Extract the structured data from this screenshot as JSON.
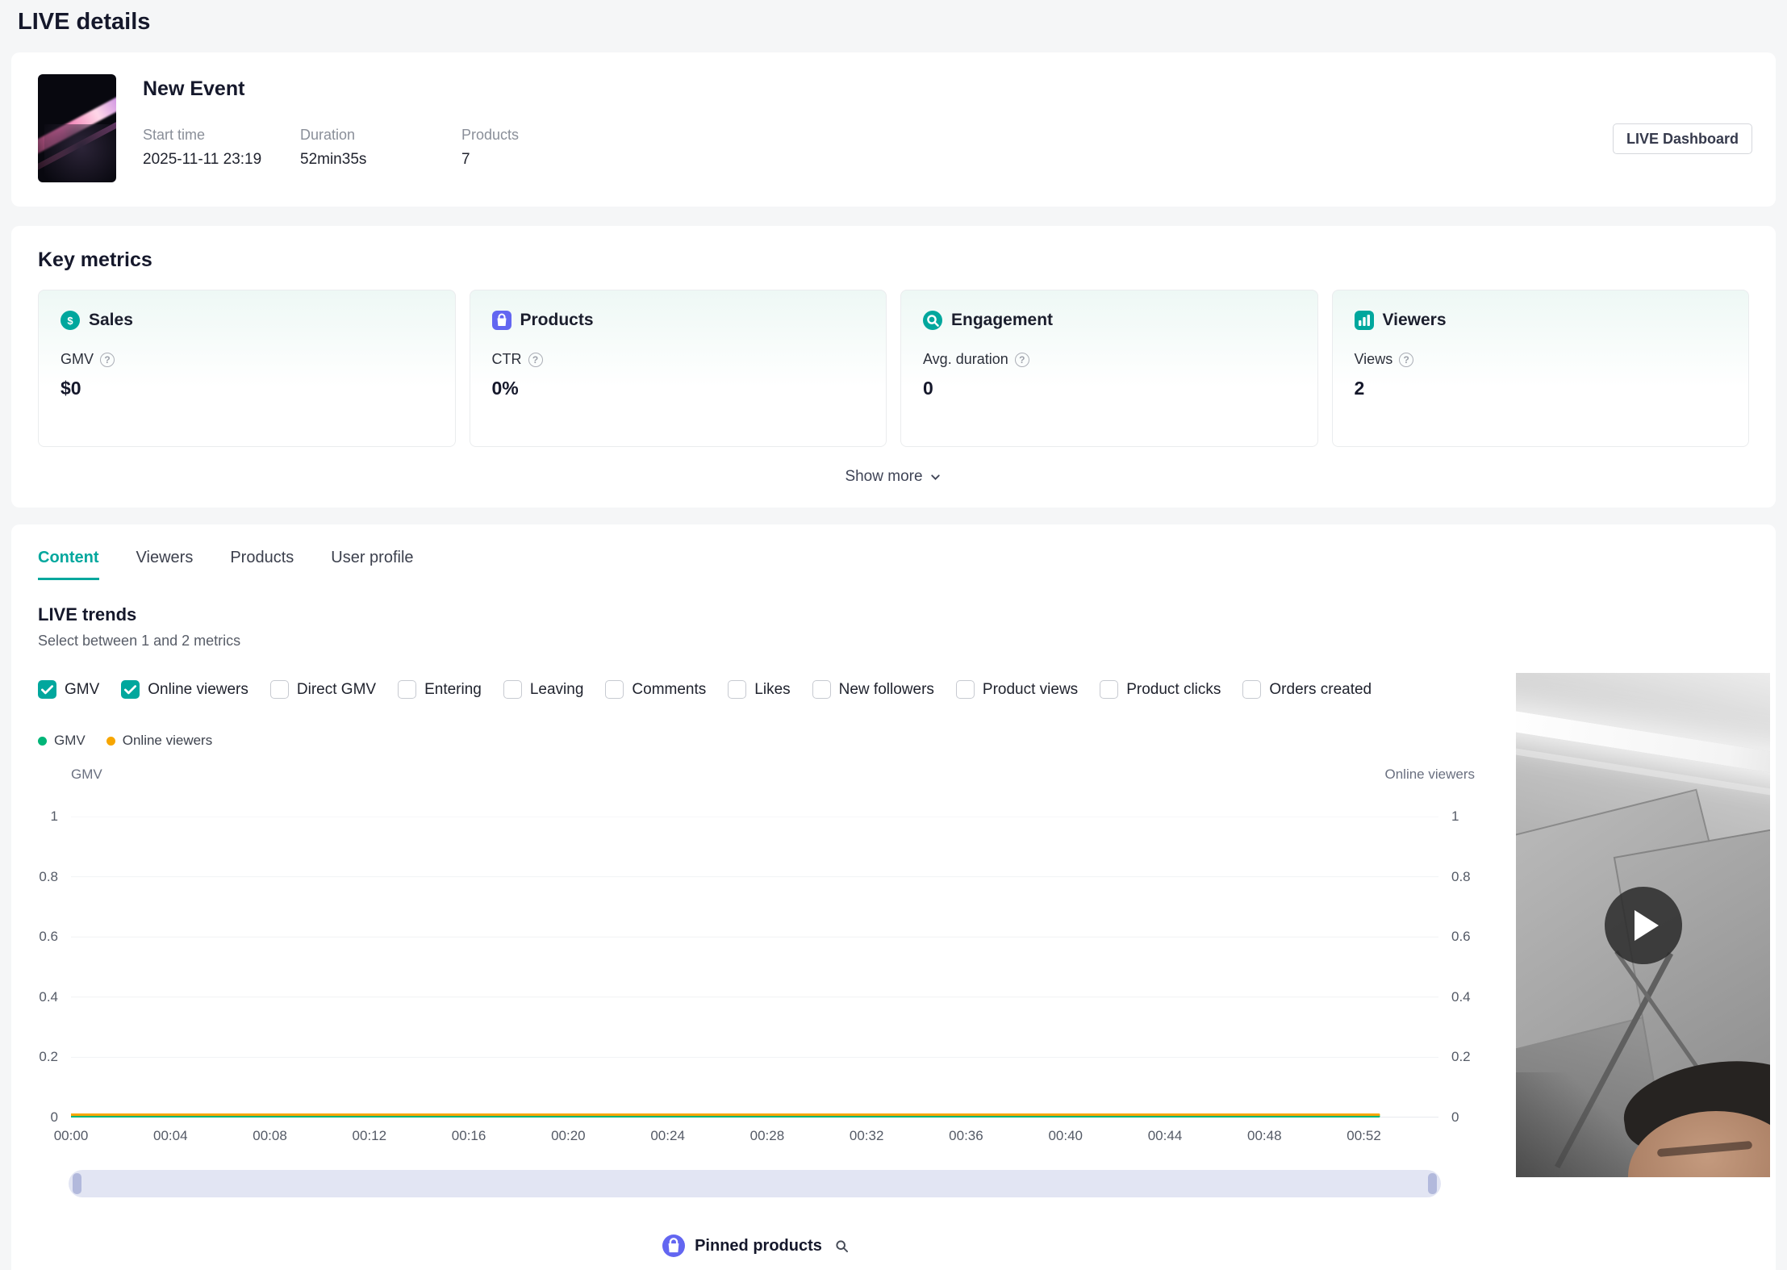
{
  "page": {
    "title": "LIVE details"
  },
  "accent_color": "#00a79d",
  "event": {
    "name": "New Event",
    "fields": [
      {
        "label": "Start time",
        "value": "2025-11-11 23:19"
      },
      {
        "label": "Duration",
        "value": "52min35s"
      },
      {
        "label": "Products",
        "value": "7"
      }
    ],
    "dashboard_button_label": "LIVE Dashboard"
  },
  "key_metrics": {
    "title": "Key metrics",
    "show_more_label": "Show more",
    "cards": [
      {
        "icon": "sales-icon",
        "icon_color": "#00a79d",
        "icon_shape": "round",
        "title": "Sales",
        "metric": "GMV",
        "value": "$0"
      },
      {
        "icon": "products-icon",
        "icon_color": "#6366f1",
        "icon_shape": "sq",
        "title": "Products",
        "metric": "CTR",
        "value": "0%"
      },
      {
        "icon": "engagement-icon",
        "icon_color": "#00a79d",
        "icon_shape": "round",
        "title": "Engagement",
        "metric": "Avg. duration",
        "value": "0"
      },
      {
        "icon": "viewers-icon",
        "icon_color": "#00a79d",
        "icon_shape": "sq",
        "title": "Viewers",
        "metric": "Views",
        "value": "2"
      }
    ]
  },
  "tabs": [
    {
      "label": "Content",
      "active": true
    },
    {
      "label": "Viewers",
      "active": false
    },
    {
      "label": "Products",
      "active": false
    },
    {
      "label": "User profile",
      "active": false
    }
  ],
  "trends": {
    "title": "LIVE trends",
    "subtitle": "Select between 1 and 2 metrics",
    "metric_options": [
      {
        "label": "GMV",
        "checked": true
      },
      {
        "label": "Online viewers",
        "checked": true
      },
      {
        "label": "Direct GMV",
        "checked": false
      },
      {
        "label": "Entering",
        "checked": false
      },
      {
        "label": "Leaving",
        "checked": false
      },
      {
        "label": "Comments",
        "checked": false
      },
      {
        "label": "Likes",
        "checked": false
      },
      {
        "label": "New followers",
        "checked": false
      },
      {
        "label": "Product views",
        "checked": false
      },
      {
        "label": "Product clicks",
        "checked": false
      },
      {
        "label": "Orders created",
        "checked": false
      }
    ],
    "legend": [
      {
        "label": "GMV",
        "color": "#00b578"
      },
      {
        "label": "Online viewers",
        "color": "#f7a600"
      }
    ]
  },
  "chart_data": {
    "type": "line",
    "title": "LIVE trends",
    "y_left_label": "GMV",
    "y_right_label": "Online viewers",
    "y_domain": [
      0,
      1
    ],
    "y_ticks": [
      0,
      0.2,
      0.4,
      0.6,
      0.8,
      1
    ],
    "x_domain_minutes": [
      0,
      55
    ],
    "x_ticks": [
      "00:00",
      "00:04",
      "00:08",
      "00:12",
      "00:16",
      "00:20",
      "00:24",
      "00:28",
      "00:32",
      "00:36",
      "00:40",
      "00:44",
      "00:48",
      "00:52"
    ],
    "x_tick_minutes": [
      0,
      4,
      8,
      12,
      16,
      20,
      24,
      28,
      32,
      36,
      40,
      44,
      48,
      52
    ],
    "grid": true,
    "legend_position": "top-left",
    "series": [
      {
        "name": "GMV",
        "axis": "left",
        "color": "#00b578",
        "x_minutes": [
          0,
          52.6
        ],
        "values": [
          0,
          0
        ]
      },
      {
        "name": "Online viewers",
        "axis": "right",
        "color": "#f7a600",
        "x_minutes": [
          0,
          52.6
        ],
        "values": [
          0,
          0
        ]
      }
    ]
  },
  "pinned_products": {
    "label": "Pinned products"
  }
}
